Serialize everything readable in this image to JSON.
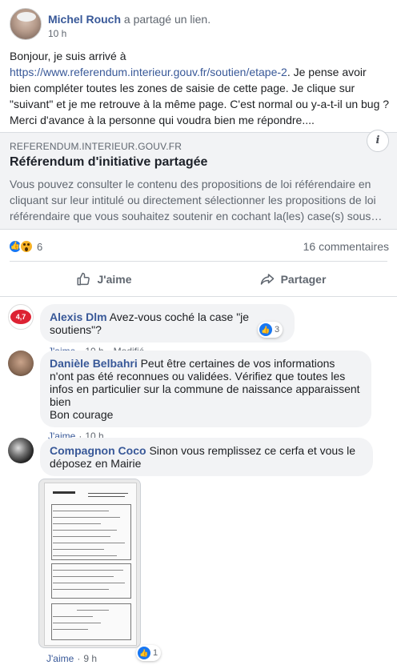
{
  "post": {
    "author": "Michel Rouch",
    "action_text": "a partagé un lien.",
    "time": "10 h",
    "message_pre": "Bonjour, je suis arrivé à ",
    "message_link": "https://www.referendum.interieur.gouv.fr/soutien/etape-2",
    "message_post": ". Je pense avoir bien compléter toutes les zones de saisie de cette page. Je clique sur \"suivant\" et je me retrouve à la même page. C'est normal ou y-a-t-il un bug ? Merci d'avance à la personne qui voudra bien me répondre...."
  },
  "link_preview": {
    "domain": "REFERENDUM.INTERIEUR.GOUV.FR",
    "title": "Référendum d'initiative partagée",
    "description": "Vous pouvez consulter le contenu des propositions de loi référendaire en cliquant sur leur intitulé ou directement sélectionner les propositions de loi référendaire que vous souhaitez soutenir en cochant la(les) case(s) sous…",
    "info_icon": "i"
  },
  "reactions": {
    "count": "6",
    "comments_count": "16 commentaires",
    "icons": [
      "like-icon",
      "wow-icon"
    ]
  },
  "actions": {
    "like_label": "J'aime",
    "share_label": "Partager"
  },
  "comments": [
    {
      "name": "Alexis Dlm",
      "text": "Avez-vous coché la case \"je soutiens\"?",
      "like_label": "J'aime",
      "time": "10 h",
      "edited": "Modifié",
      "reaction_count": "3",
      "avatar_text": "4,7"
    },
    {
      "name": "Danièle Belbahri",
      "text": "Peut être certaines de vos informations n'ont pas été reconnues ou validées. Vérifiez que toutes les infos en particulier sur la commune de naissance apparaissent bien",
      "text2": "Bon courage",
      "like_label": "J'aime",
      "time": "10 h"
    },
    {
      "name": "Compagnon Coco",
      "text": "Sinon vous remplissez ce cerfa et vous le déposez en Mairie",
      "like_label": "J'aime",
      "time": "9 h",
      "reaction_count": "1"
    }
  ],
  "colors": {
    "link": "#385898",
    "like_blue": "#1877f2",
    "bubble_bg": "#f2f3f5",
    "meta_gray": "#606770"
  }
}
